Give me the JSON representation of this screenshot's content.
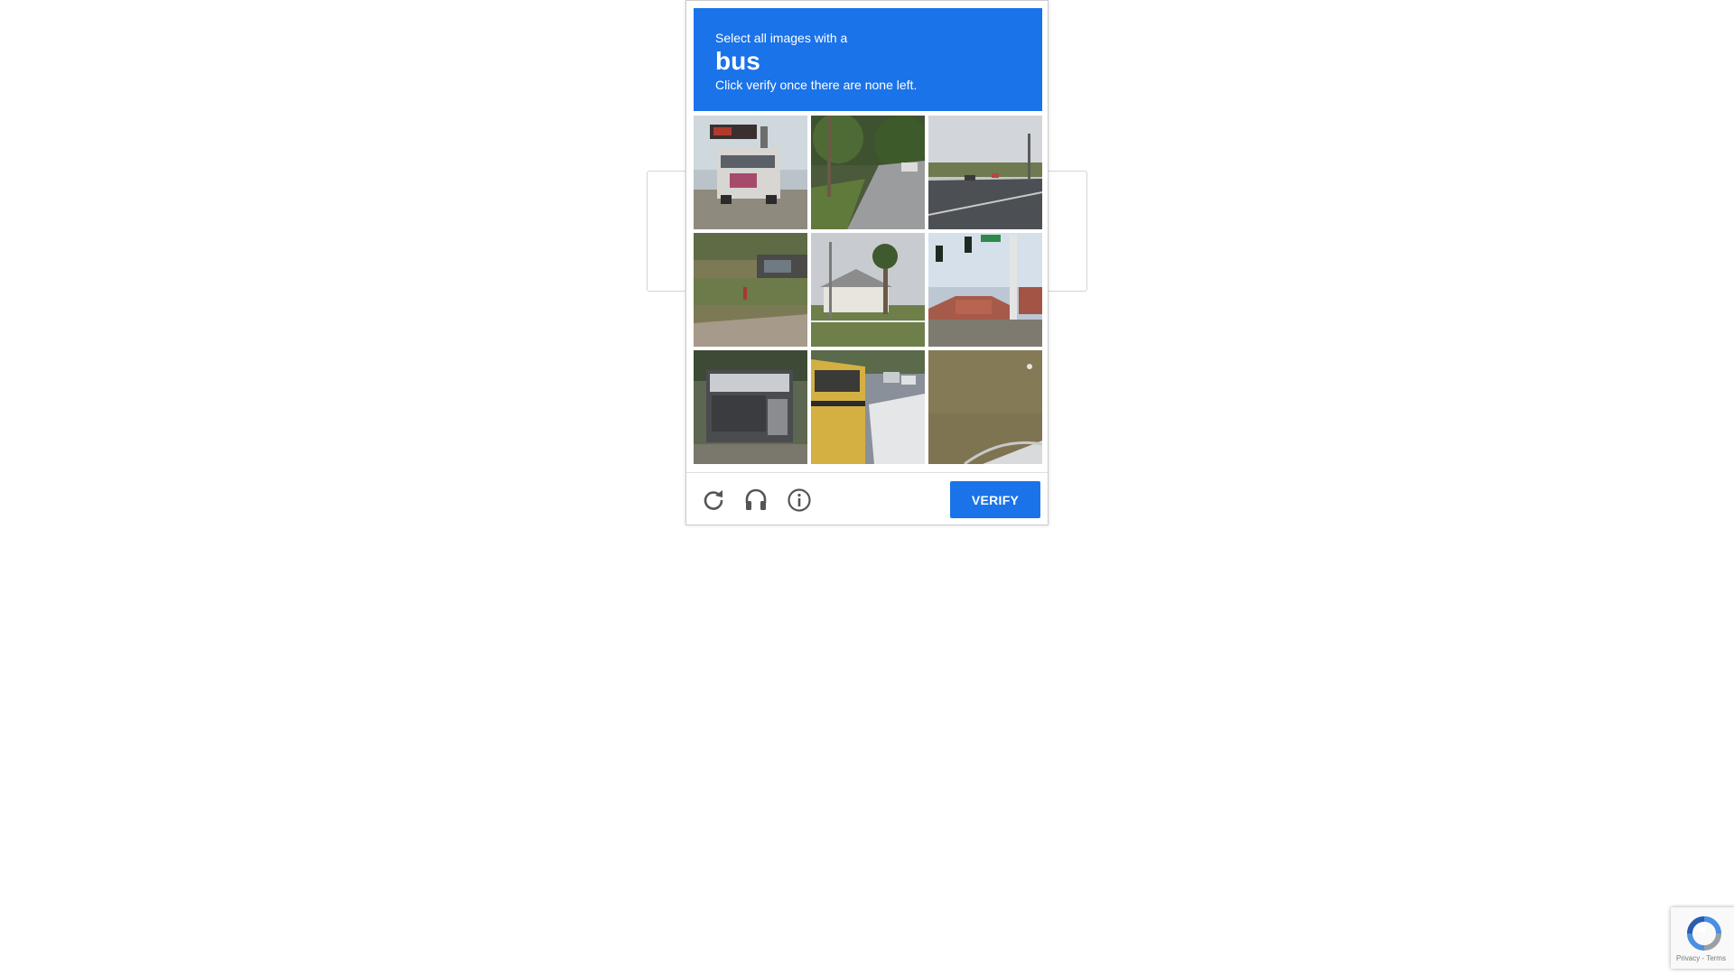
{
  "challenge": {
    "instruction_line1": "Select all images with a",
    "target_object": "bus",
    "instruction_line3": "Click verify once there are none left.",
    "tiles": [
      {
        "index": 1,
        "scene": "bus-parked-under-sign"
      },
      {
        "index": 2,
        "scene": "residential-road-trees"
      },
      {
        "index": 3,
        "scene": "highway-traffic"
      },
      {
        "index": 4,
        "scene": "yard-with-truck"
      },
      {
        "index": 5,
        "scene": "house-with-palm-tree"
      },
      {
        "index": 6,
        "scene": "intersection-traffic-lights"
      },
      {
        "index": 7,
        "scene": "bus-rear-view"
      },
      {
        "index": 8,
        "scene": "yellow-school-bus"
      },
      {
        "index": 9,
        "scene": "grass-and-car-corner"
      }
    ]
  },
  "footer": {
    "reload_icon": "reload-icon",
    "audio_icon": "headphones-icon",
    "info_icon": "info-icon",
    "verify_label": "VERIFY"
  },
  "recaptcha_badge": {
    "links": "Privacy - Terms"
  },
  "colors": {
    "accent": "#1a73e8",
    "icon_gray": "#555555"
  }
}
